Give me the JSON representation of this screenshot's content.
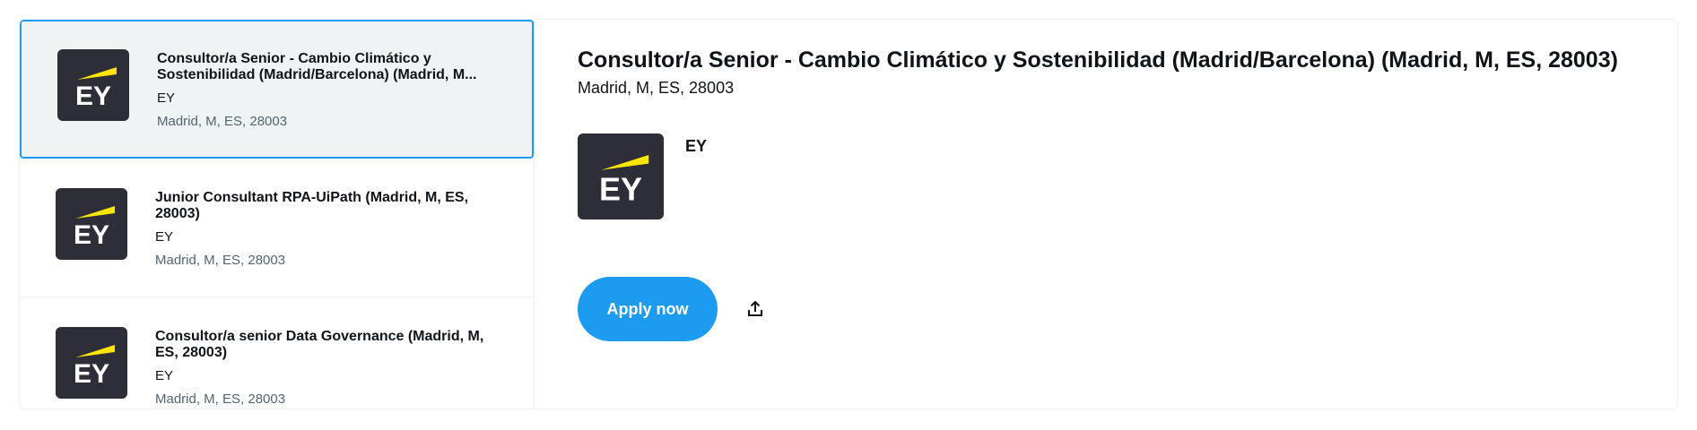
{
  "job_list": [
    {
      "title": "Consultor/a Senior - Cambio Climático y Sostenibilidad (Madrid/Barcelona) (Madrid, M...",
      "company": "EY",
      "location": "Madrid, M, ES, 28003",
      "selected": true
    },
    {
      "title": "Junior Consultant RPA-UiPath (Madrid, M, ES, 28003)",
      "company": "EY",
      "location": "Madrid, M, ES, 28003",
      "selected": false
    },
    {
      "title": "Consultor/a senior Data Governance (Madrid, M, ES, 28003)",
      "company": "EY",
      "location": "Madrid, M, ES, 28003",
      "selected": false
    }
  ],
  "detail": {
    "title": "Consultor/a Senior - Cambio Climático y Sostenibilidad (Madrid/Barcelona) (Madrid, M, ES, 28003)",
    "location": "Madrid, M, ES, 28003",
    "company": "EY",
    "apply_label": "Apply now",
    "share_icon": "share-icon"
  },
  "logo": {
    "text": "EY",
    "background": "#2e2e38",
    "accent": "#ffe600"
  },
  "colors": {
    "accent": "#1d9bf0",
    "selected_bg": "#eff3f4",
    "muted_text": "#536471"
  }
}
